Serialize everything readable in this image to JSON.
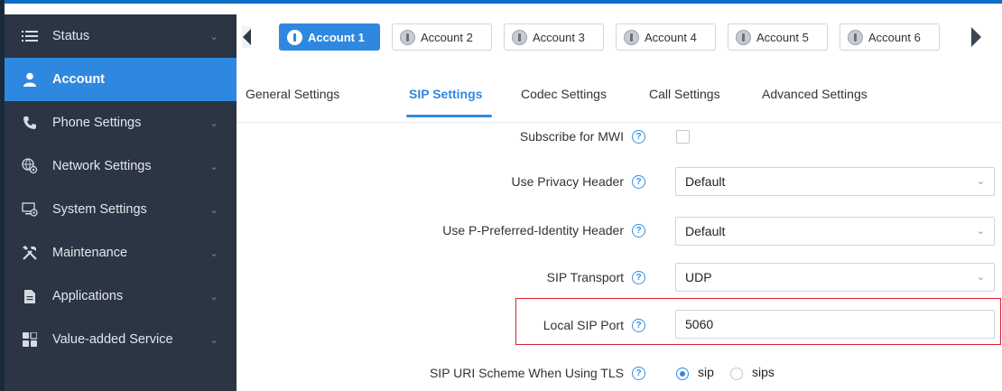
{
  "sidebar": {
    "items": [
      {
        "label": "Status",
        "icon": "list-icon",
        "active": false
      },
      {
        "label": "Account",
        "icon": "person-icon",
        "active": true
      },
      {
        "label": "Phone Settings",
        "icon": "phone-icon",
        "active": false
      },
      {
        "label": "Network Settings",
        "icon": "network-gear-icon",
        "active": false
      },
      {
        "label": "System Settings",
        "icon": "monitor-gear-icon",
        "active": false
      },
      {
        "label": "Maintenance",
        "icon": "tools-icon",
        "active": false
      },
      {
        "label": "Applications",
        "icon": "document-icon",
        "active": false
      },
      {
        "label": "Value-added Service",
        "icon": "grid-icon",
        "active": false
      }
    ]
  },
  "accounts": {
    "tabs": [
      {
        "label": "Account 1",
        "active": true
      },
      {
        "label": "Account 2",
        "active": false
      },
      {
        "label": "Account 3",
        "active": false
      },
      {
        "label": "Account 4",
        "active": false
      },
      {
        "label": "Account 5",
        "active": false
      },
      {
        "label": "Account 6",
        "active": false
      }
    ]
  },
  "subtabs": [
    {
      "label": "General Settings",
      "active": false
    },
    {
      "label": "SIP Settings",
      "active": true
    },
    {
      "label": "Codec Settings",
      "active": false
    },
    {
      "label": "Call Settings",
      "active": false
    },
    {
      "label": "Advanced Settings",
      "active": false
    }
  ],
  "form": {
    "subscribe_mwi": {
      "label": "Subscribe for MWI",
      "checked": false
    },
    "privacy_header": {
      "label": "Use Privacy Header",
      "value": "Default"
    },
    "ppi_header": {
      "label": "Use P-Preferred-Identity Header",
      "value": "Default"
    },
    "sip_transport": {
      "label": "SIP Transport",
      "value": "UDP"
    },
    "local_sip_port": {
      "label": "Local SIP Port",
      "value": "5060"
    },
    "uri_scheme": {
      "label": "SIP URI Scheme When Using TLS",
      "options": [
        "sip",
        "sips"
      ],
      "selected": "sip"
    }
  },
  "colors": {
    "accent": "#2f88e0",
    "sidebar_bg": "#2b3543",
    "highlight": "#d9232e"
  }
}
